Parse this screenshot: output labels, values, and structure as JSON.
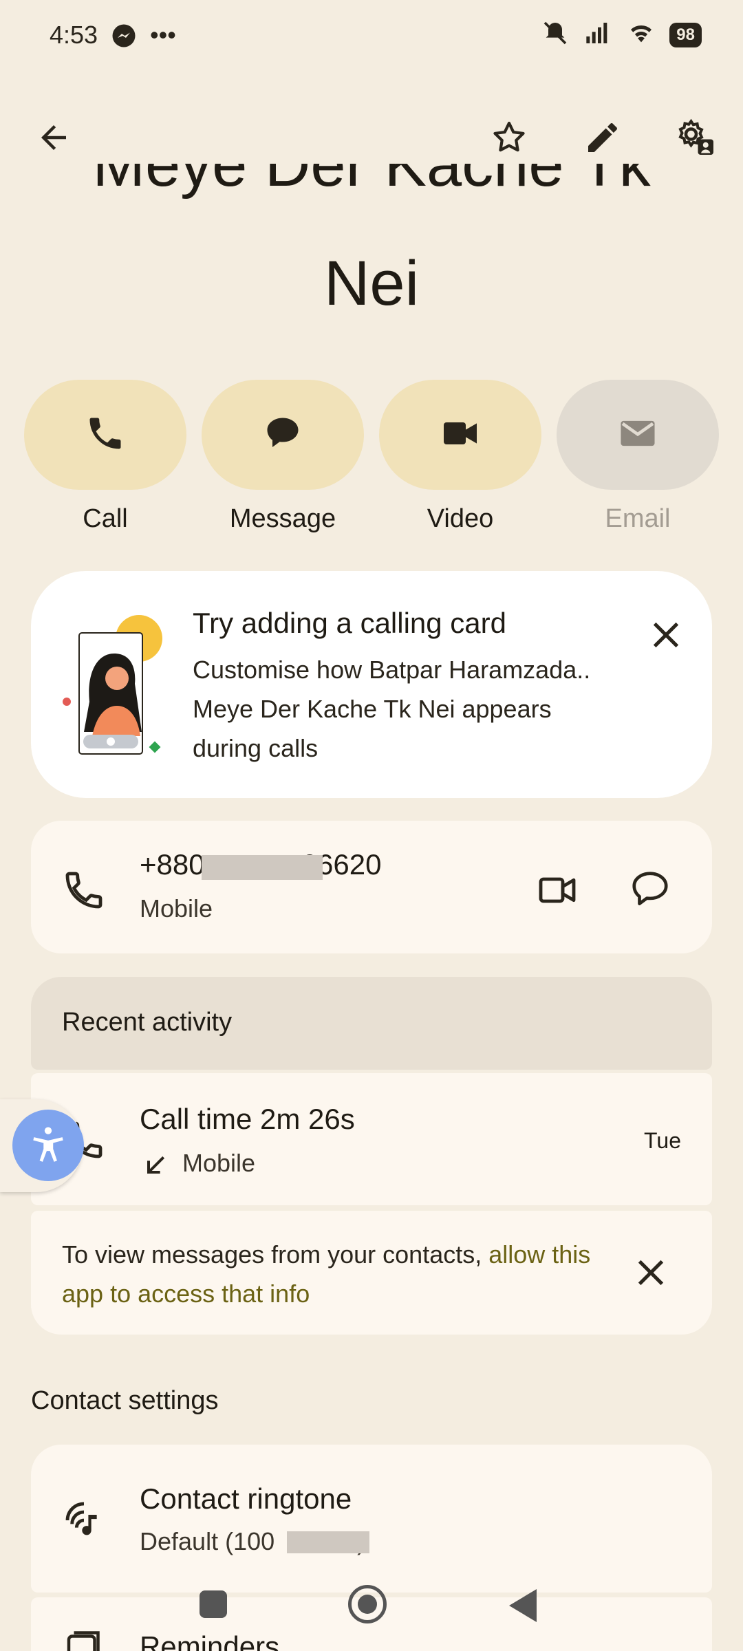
{
  "status_bar": {
    "time": "4:53",
    "battery": "98"
  },
  "contact": {
    "name_line1": "Meye Der Kache Tk",
    "name_line2": "Nei"
  },
  "quick_actions": [
    {
      "label": "Call",
      "icon": "phone-icon",
      "enabled": true
    },
    {
      "label": "Message",
      "icon": "message-icon",
      "enabled": true
    },
    {
      "label": "Video",
      "icon": "video-icon",
      "enabled": true
    },
    {
      "label": "Email",
      "icon": "email-icon",
      "enabled": false
    }
  ],
  "calling_card": {
    "title": "Try adding a calling card",
    "body": "Customise how Batpar Haramzada..  Meye Der Kache Tk Nei appears during calls"
  },
  "phone": {
    "number": "+880            66620",
    "type": "Mobile"
  },
  "recent_activity": {
    "title": "Recent activity",
    "item": {
      "summary": "Call time 2m 26s",
      "type": "Mobile",
      "day": "Tue"
    }
  },
  "messages_prompt": {
    "text": "To view messages from your contacts, ",
    "link": "allow this app to access that info"
  },
  "contact_settings": {
    "title": "Contact settings",
    "ringtone_title": "Contact ringtone",
    "ringtone_value": "Default (100        96)",
    "reminders_title": "Reminders"
  },
  "colors": {
    "background": "#f4ede0",
    "action_bg": "#f1e2b9",
    "card": "#fdf7ef",
    "link": "#6b6214",
    "a11y": "#7fa4ee"
  }
}
